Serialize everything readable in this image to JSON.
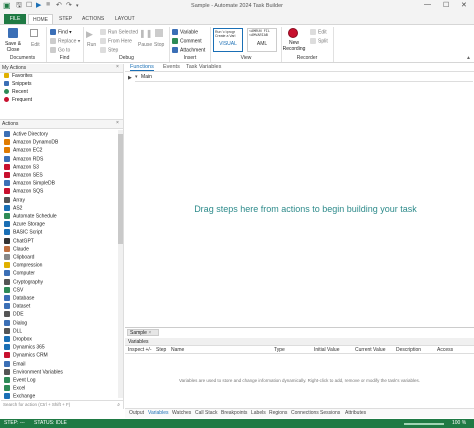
{
  "window": {
    "title": "Sample - Automate 2024 Task Builder"
  },
  "ribbon_tabs": [
    "FILE",
    "HOME",
    "STEP",
    "ACTIONS",
    "LAYOUT"
  ],
  "ribbon": {
    "documents": {
      "save_close": "Save &\nClose",
      "edit": "Edit",
      "label": "Documents"
    },
    "find": {
      "find": "Find",
      "replace": "Replace",
      "goto": "Go to",
      "label": "Find"
    },
    "debug": {
      "run": "Run",
      "run_selected": "Run Selected",
      "from_here": "From Here",
      "step": "Step",
      "pause": "Pause",
      "stop": "Stop",
      "label": "Debug"
    },
    "insert": {
      "variable": "Variable",
      "comment": "Comment",
      "attachment": "Attachment",
      "label": "Insert"
    },
    "view": {
      "visual_preview": "Run 'c:\\progr\nCreate a Vari",
      "visual": "VISUAL",
      "aml_preview": "<AMRUN FIL\n<AMVARIAB",
      "aml": "AML",
      "label": "View"
    },
    "recorder": {
      "new_recording": "New\nRecording",
      "edit": "Edit",
      "split": "Split",
      "label": "Recorder"
    }
  },
  "my_actions": {
    "header": "My Actions",
    "items": [
      "Favorites",
      "Snippets",
      "Recent",
      "Frequent"
    ]
  },
  "actions": {
    "header": "Actions",
    "items": [
      "Active Directory",
      "Amazon DynamoDB",
      "Amazon EC2",
      "Amazon RDS",
      "Amazon S3",
      "Amazon SES",
      "Amazon SimpleDB",
      "Amazon SQS",
      "Array",
      "AS2",
      "Automate Schedule",
      "Azure Storage",
      "BASIC Script",
      "ChatGPT",
      "Claude",
      "Clipboard",
      "Compression",
      "Computer",
      "Cryptography",
      "CSV",
      "Database",
      "Dataset",
      "DDE",
      "Dialog",
      "DLL",
      "Dropbox",
      "Dynamics 365",
      "Dynamics CRM",
      "Email",
      "Environment Variables",
      "Event Log",
      "Excel",
      "Exchange"
    ],
    "search_placeholder": "Search for action (Ctrl + Shift + F)"
  },
  "main_tabs": [
    "Functions",
    "Events",
    "Task Variables"
  ],
  "function_selector": "Main",
  "empty_message": "Drag steps here from actions to begin building your task",
  "bottom_panel": {
    "tab_label": "Sample",
    "header": "Variables",
    "columns": [
      "Inspect +/-",
      "Step",
      "Name",
      "Type",
      "Initial Value",
      "Current Value",
      "Description",
      "Access"
    ],
    "hint": "Variables are used to store and change information dynamically. Right-click to add, remove or modify the task's variables.",
    "tabs": [
      "Output",
      "Variables",
      "Watches",
      "Call Stack",
      "Breakpoints",
      "Labels",
      "Regions",
      "Connections",
      "Sessions",
      "Attributes"
    ]
  },
  "status": {
    "step": "STEP: ---",
    "status": "STATUS: IDLE",
    "zoom": "100 %"
  },
  "colors": {
    "accent_green": "#1f7a44",
    "accent_blue": "#1a6fb5",
    "status_bar": "#1f7a44"
  }
}
